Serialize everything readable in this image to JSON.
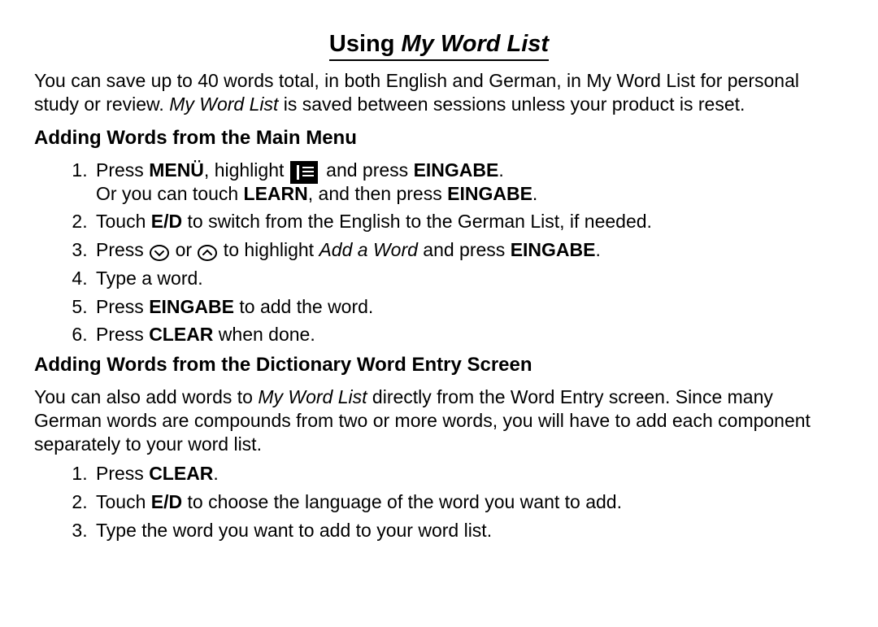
{
  "title": {
    "prefix": "Using ",
    "italic": "My Word List"
  },
  "intro": {
    "part1": "You can save up to 40 words total, in both English and German, in My Word List for per­sonal study or review. ",
    "italic": "My Word List",
    "part2": " is saved between sessions unless your product is reset."
  },
  "section1": {
    "heading": "Adding Words from the Main Menu",
    "steps": [
      {
        "a": "Press ",
        "b": "MENÜ",
        "c": ", highlight ",
        "d": " and press ",
        "e": "EINGABE",
        "f": ".",
        "line2a": "Or you can touch ",
        "line2b": "LEARN",
        "line2c": ", and then press ",
        "line2d": "EINGABE",
        "line2e": "."
      },
      {
        "a": "Touch ",
        "b": "E/D",
        "c": " to switch from the English to the German List, if needed."
      },
      {
        "a": "Press ",
        "b": " or ",
        "c": " to highlight ",
        "d": "Add a Word",
        "e": " and press ",
        "f": "EINGABE",
        "g": "."
      },
      {
        "a": "Type a word."
      },
      {
        "a": "Press ",
        "b": "EINGABE",
        "c": " to add the word."
      },
      {
        "a": "Press ",
        "b": "CLEAR",
        "c": " when done."
      }
    ]
  },
  "section2": {
    "heading": "Adding Words from the Dictionary Word Entry Screen",
    "intro": {
      "a": "You can also add words to ",
      "b": "My Word List",
      "c": " directly from the Word Entry screen. Since many German words are compounds from two or more words, you will have to add each component separately to your word list."
    },
    "steps": [
      {
        "a": "Press ",
        "b": "CLEAR",
        "c": "."
      },
      {
        "a": "Touch ",
        "b": "E/D",
        "c": " to choose the language of the word you want to add."
      },
      {
        "a": "Type the word you want to add to your word list."
      }
    ]
  }
}
